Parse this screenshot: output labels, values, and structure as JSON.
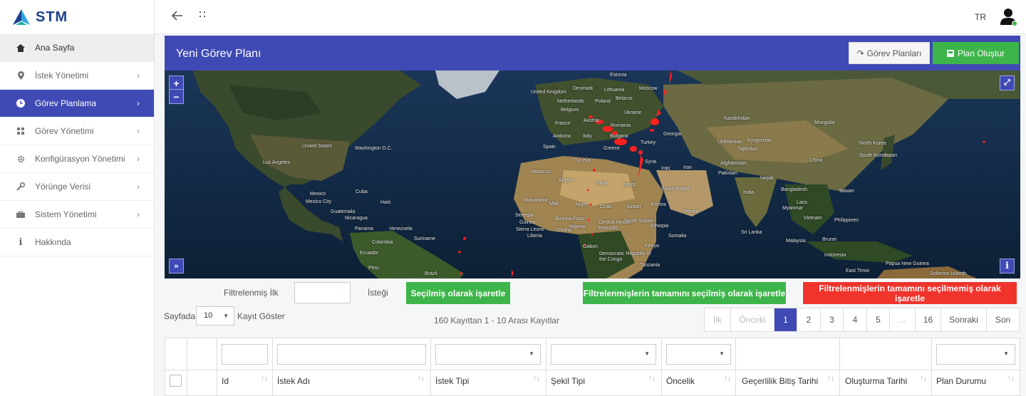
{
  "brand": {
    "name": "STM"
  },
  "topbar": {
    "language": "TR"
  },
  "sidebar": {
    "items": [
      {
        "label": "Ana Sayfa",
        "icon": "home-icon"
      },
      {
        "label": "İstek Yönetimi",
        "icon": "map-pin-icon"
      },
      {
        "label": "Görev Planlama",
        "icon": "clock-icon"
      },
      {
        "label": "Görev Yönetimi",
        "icon": "grid-icon"
      },
      {
        "label": "Konfigürasyon Yönetimi",
        "icon": "gear-icon"
      },
      {
        "label": "Yörünge Verisi",
        "icon": "wrench-icon"
      },
      {
        "label": "Sistem Yönetimi",
        "icon": "briefcase-icon"
      },
      {
        "label": "Hakkında",
        "icon": "info-icon"
      }
    ]
  },
  "header": {
    "title": "Yeni Görev Planı",
    "plans_button": "Görev Planları",
    "create_button": "Plan Oluştur"
  },
  "map": {
    "labels": {
      "estonia": "Estonia",
      "moscow": "Moscow",
      "uk": "United Kingdom",
      "denmark": "Denmark",
      "lithuania": "Lithuania",
      "belarus": "Belarus",
      "netherlands": "Netherlands",
      "poland": "Poland",
      "belgium": "Belgium",
      "ukraine": "Ukraine",
      "france": "France",
      "austria": "Austria",
      "romania": "Romania",
      "andorra": "Andorra",
      "italy": "Italy",
      "bulgaria": "Bulgaria",
      "spain": "Spain",
      "greece": "Greece",
      "turkey": "Turkey",
      "georgia": "Georgia",
      "kazakhstan": "Kazakhstan",
      "mongolia": "Mongolia",
      "kyrgyzstan": "Kyrgyzstan",
      "northkorea": "North Korea",
      "southkorea": "South Korea",
      "japan": "Japan",
      "uzbekistan": "Uzbekistan",
      "tajikistan": "Tajikistan",
      "afghanistan": "Afghanistan",
      "china": "China",
      "tunisia": "Tunisia",
      "syria": "Syria",
      "iraq": "Iraq",
      "iran": "Iran",
      "pakistan": "Pakistan",
      "nepal": "Nepal",
      "india": "India",
      "bangladesh": "Bangladesh",
      "taiwan": "Taiwan",
      "myanmar": "Myanmar",
      "laos": "Laos",
      "vietnam": "Vietnam",
      "philippines": "Philippines",
      "malaysia": "Malaysia",
      "brunei": "Brunei",
      "indonesia": "Indonesia",
      "papuanewguinea": "Papua New Guinea",
      "easttimor": "East Timor",
      "solomon": "Solomon Islands",
      "srilanka": "Sri Lanka",
      "morocco": "Morocco",
      "algeria": "Algeria",
      "libya": "Libya",
      "egypt": "Egypt",
      "saudi": "Saudi Arabia",
      "mauritania": "Mauritania",
      "mali": "Mali",
      "niger": "Niger",
      "chad": "Chad",
      "sudan": "Sudan",
      "eritrea": "Eritrea",
      "yemen": "Yemen",
      "senegal": "Senegal",
      "guinea": "Guinea",
      "burkina": "Burkina Faso",
      "sierraleone": "Sierra Leone",
      "liberia": "Liberia",
      "ghana": "Ghana",
      "nigeria": "Nigeria",
      "car": "Central African Republic",
      "southsudan": "South Sudan",
      "ethiopia": "Ethiopia",
      "somalia": "Somalia",
      "kenya": "Kenya",
      "gabon": "Gabon",
      "drc": "Democratic Republic of the Congo",
      "tanzania": "Tanzania",
      "unitedstates": "United States",
      "washington": "Washington D.C.",
      "losangeles": "Los Angeles",
      "mexico": "Mexico",
      "mexicocity": "Mexico City",
      "cuba": "Cuba",
      "haiti": "Haiti",
      "guatemala": "Guatemala",
      "nicaragua": "Nicaragua",
      "panama": "Panama",
      "venezuela": "Venezuela",
      "colombia": "Colombia",
      "suriname": "Suriname",
      "ecuador": "Ecuador",
      "peru": "Peru",
      "brazil": "Brazil"
    }
  },
  "filter": {
    "label_prefix": "Filtrelenmiş İlk",
    "label_suffix": "İsteği",
    "mark_selected": "Seçilmiş olarak işaretle",
    "mark_all_selected": "Filtrelenmişlerin tamamını seçilmiş olarak işaretle",
    "mark_all_unselected": "Filtrelenmişlerin tamamını seçilmemiş olarak işaretle"
  },
  "listing": {
    "page_size_label": "Sayfada",
    "page_size": "10",
    "page_size_suffix": "Kayıt Göster",
    "records_info": "160 Kayıttan 1 - 10 Arası Kayıtlar"
  },
  "pagination": {
    "first": "İlk",
    "prev": "Önceki",
    "p1": "1",
    "p2": "2",
    "p3": "3",
    "p4": "4",
    "p5": "5",
    "ellipsis": "...",
    "p16": "16",
    "next": "Sonraki",
    "last": "Son"
  },
  "table": {
    "columns": [
      "Id",
      "İstek Adı",
      "İstek Tipi",
      "Şekil Tipi",
      "Öncelik",
      "Geçerlilik Bitiş Tarihi",
      "Oluşturma Tarihi",
      "Plan Durumu"
    ]
  },
  "colors": {
    "primary": "#3f4ab5",
    "success": "#3db54a",
    "danger": "#f0342c"
  }
}
